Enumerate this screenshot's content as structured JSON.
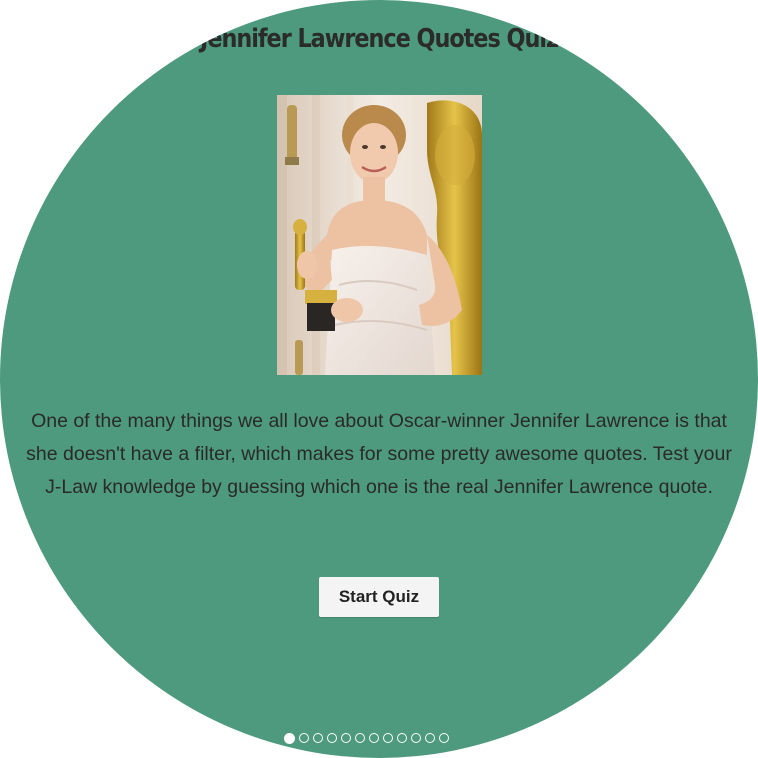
{
  "quiz": {
    "title": "Jennifer Lawrence Quotes Quiz",
    "description": "One of the many things we all love about Oscar-winner Jennifer Lawrence is that she doesn't have a filter, which makes for some pretty awesome quotes. Test your J-Law knowledge by guessing which one is the real Jennifer Lawrence quote.",
    "start_label": "Start Quiz",
    "background_color": "#4e9a7e"
  },
  "pagination": {
    "total": 12,
    "active_index": 0
  }
}
